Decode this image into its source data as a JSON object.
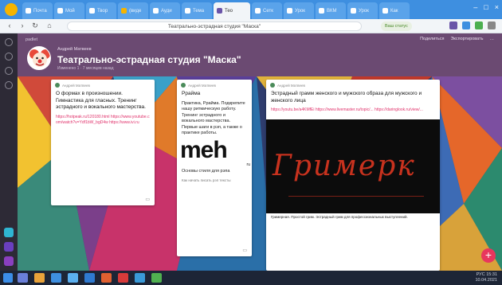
{
  "browser": {
    "tabs": [
      {
        "label": "Почта",
        "color": "#ffffff"
      },
      {
        "label": "Мой",
        "color": "#ffffff"
      },
      {
        "label": "Твор",
        "color": "#ffffff"
      },
      {
        "label": "(виде",
        "color": "#f5b400"
      },
      {
        "label": "Ауди",
        "color": "#ffffff"
      },
      {
        "label": "Тема",
        "color": "#ffffff"
      },
      {
        "label": "Тео",
        "color": "#6a54a8",
        "active": true
      },
      {
        "label": "Сетк",
        "color": "#ffffff"
      },
      {
        "label": "Урок",
        "color": "#ffffff"
      },
      {
        "label": "ВКМ",
        "color": "#ffffff"
      },
      {
        "label": "Урок",
        "color": "#ffffff"
      },
      {
        "label": "Как",
        "color": "#ffffff"
      }
    ],
    "address": "Театрально-эстрадная студия \"Маска\"",
    "secure_pill": "Ваш статус",
    "window_controls": [
      "–",
      "□",
      "×"
    ]
  },
  "board": {
    "breadcrumb": "padlet",
    "header_actions": [
      "Поделиться",
      "Экспортировать",
      "…"
    ],
    "author": "Андрей Матвеев",
    "title": "Театрально-эстрадная студия \"Маска\"",
    "subtitle": "Изменено 1 · 7 месяцев назад",
    "fab_label": "+"
  },
  "cards": {
    "card1": {
      "author": "Андрей Матвеев",
      "title": "О формах в произношении. Гимнастика для гласных. Тренинг эстрадного и вокального мастерства.",
      "link": "https://hotpeak.ru/120180.html https://www.youtube.com/watch?v=Ydf1bW_bgD4w https://www.ivi.ru",
      "foot_icon": "comment-icon"
    },
    "card2": {
      "author": "Андрей Матвеев",
      "title": "Ррайма",
      "text": "Практика, Ррайма. Подкрепите нашу ритмическую работу. Тренинг эстрадного и вокального мастерства. Первые шаги в рэп, а также о практике работы.",
      "image_text": "meh",
      "image_sub": "ru",
      "caption": "Основы стиля для рэпа",
      "caption_sub": "Как начать писать рэп тексты"
    },
    "card3": {
      "author": "Андрей Матвеев",
      "title": "Эстрадный грамм женского и мужского образа для мужского и женского лица",
      "link": "https://youtu.be/a4KMfEi https://www.livemaster.ru/topic/... https://daringlook.ru/view/...",
      "image_text": "Гримерк",
      "caption": "Гримерная. Простой грим. Эстрадный грим для профессиональных выступлений."
    }
  },
  "taskbar": {
    "time": "15:31",
    "date": "10.04.2021",
    "lang": "РУС"
  }
}
